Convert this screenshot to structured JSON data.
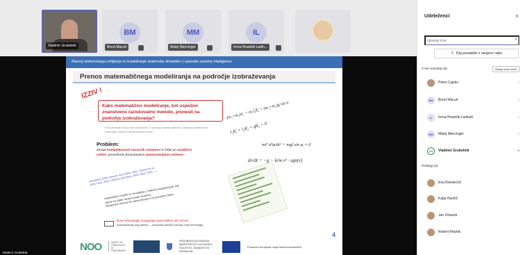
{
  "stage": {
    "tiles": [
      {
        "id": "vg",
        "name": "Vladimir Grubelnik"
      },
      {
        "id": "bm",
        "initials": "BM",
        "name": "Borut Macuh"
      },
      {
        "id": "mm",
        "initials": "MM",
        "name": "Matej Mencinger"
      },
      {
        "id": "il",
        "initials": "IL",
        "name": "Irena Hrastnik Ladin..."
      }
    ],
    "self_name": "Vladimir Grubelnik"
  },
  "slide": {
    "header": "Razvoj sistemskega mišljenja in modeliranje sistemske dinamike z uporabo umetne inteligence",
    "title": "Prenos matematičnega modeliranja na področje izobraževanja",
    "izziv": "IZZIV !",
    "question": "Kako matematično modeliranje, kot uspešno znanstveno raziskovalno metodo, prenesti na področje izobraževanja?",
    "note": "Proučevanje relacij med količinami, ki določajo stanje sistema, oblikujejo sisteme za reševanje sistema diferencialnih enačb",
    "problem_label": "Problem:",
    "problem_text_a": "Zaradi ",
    "problem_text_b": "kompleksnosti naravnih sistemov",
    "problem_text_c": " in želje po ",
    "problem_text_d": "analitični rešitvi",
    "problem_text_e": ", prevečkrat obravnavamo ",
    "problem_text_f": "poenostavljene sisteme",
    "refs": "(Grubelnik, 2009; Osborne and Collins, 2001; Osborne et al., 2003; Haus, 2004; Osborne and Dillon, 2008; Sokol, 2011, ...)",
    "bullet1": "matematični modeli ne sovpadajo z realnimi eksperimenti, kar",
    "bullet2": "vpliva na slabo razumevanje sistemov",
    "bullet3": "odtujenost učenca od naravoslovja in že posredno fizike",
    "eq1": "(m₁+m₂)ẍ₁ + m₂l₂θ̈₂ = (m₁+m₂)g sin α",
    "eq2": "l₁θ̈₁ + l₂θ̈₂ + gθ₂ = 0",
    "eq3": "ml² d²φ/dt² + mgl sin φ = 0",
    "eq4": "dv/dt = −g − k/m v² · sgn(v)",
    "new_tech": "Nove tehnologije omogočajo premostitev teh izzivov",
    "new_tech_sub": "(izobraževanje (log sistem) — prepočasi sledimo razvoju novih tehnologij)",
    "page": "4",
    "logo_noo": "NOO",
    "noo_text": "NAČRT ZA OKREVANJE IN ODPORNOST",
    "rs_text": "REPUBLIKA SLOVENIJA MINISTRSTVO ZA VISOKO ŠOLSTVO, ZNANOST IN INOVACIJE",
    "eu_text": "Financira Evropska unija NextGenerationEU"
  },
  "panel": {
    "title": "Udeleženci",
    "close": "×",
    "search_placeholder": "Iskanje ime",
    "share": "Daj povabilo v skupno rabo",
    "in_meeting": "V tem srečanju (5)",
    "mute_all": "Izklopi zvok vsem",
    "suggested": "Predlogi (4)",
    "meeting": [
      {
        "name": "Petra Cajnko",
        "initials": "",
        "photo": true
      },
      {
        "name": "Borut Macuh",
        "initials": "BM",
        "photo": false
      },
      {
        "name": "Irena Hrastnik Ladinek",
        "initials": "IL",
        "photo": false
      },
      {
        "name": "Matej Mencinger",
        "initials": "MM",
        "photo": false
      },
      {
        "name": "Vladimir Grubelnik",
        "initials": "VG",
        "photo": false
      }
    ],
    "suggestions": [
      {
        "name": "Eva Klemenčič"
      },
      {
        "name": "Katja Hanžič"
      },
      {
        "name": "Jan Zmazek"
      },
      {
        "name": "Robert Repnik"
      }
    ]
  }
}
